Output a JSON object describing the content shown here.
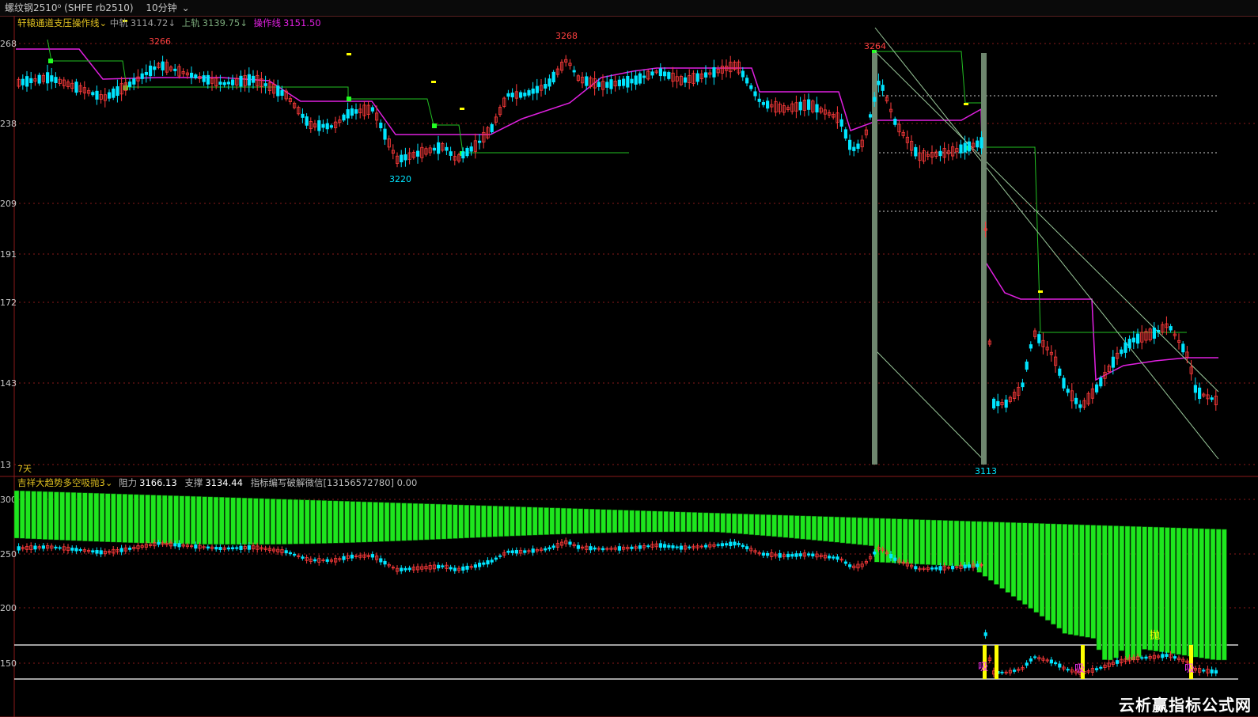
{
  "header": {
    "instrument": "螺纹钢2510⁰ (SHFE rb2510)",
    "period": "10分钟"
  },
  "indicators": {
    "main_name": "轩辕通道支压操作线",
    "main_mid_label": "中轨",
    "main_mid_value": "3114.72↓",
    "main_up_label": "上轨",
    "main_up_value": "3139.75↓",
    "main_op_label": "操作线",
    "main_op_value": "3151.50",
    "sub_name": "吉祥大趋势多空吸抛3",
    "sub_res_label": "阻力",
    "sub_res_value": "3166.13",
    "sub_sup_label": "支撑",
    "sub_sup_value": "3134.44",
    "sub_note": "指标编写破解微信[13156572780] 0.00",
    "days_label": "7天"
  },
  "watermark": "云析赢指标公式网",
  "colors": {
    "up": "#ff3b3b",
    "down": "#00e5ff",
    "op_line": "#e020e0",
    "step_line": "#22c022",
    "channel": "#9ac89a",
    "bars": "#1ee61e",
    "grid": "#8a1a1a",
    "yellow": "#ffff00"
  },
  "chart_data": [
    {
      "type": "candlestick",
      "ylim": [
        3113,
        3271
      ],
      "yticks": [
        "268",
        "238",
        "209",
        "191",
        "172",
        "143",
        "13"
      ],
      "annotations": [
        "3266",
        "3268",
        "3264",
        "3220",
        "3113"
      ],
      "series": [
        {
          "name": "中轨",
          "value": 3114.72
        },
        {
          "name": "上轨",
          "value": 3139.75
        },
        {
          "name": "操作线",
          "value": 3151.5
        }
      ]
    },
    {
      "type": "bar",
      "yticks": [
        "300",
        "250",
        "200",
        "150"
      ],
      "labels": [
        "吸",
        "吸",
        "吸",
        "抛"
      ],
      "series": [
        {
          "name": "阻力",
          "value": 3166.13
        },
        {
          "name": "支撑",
          "value": 3134.44
        }
      ]
    }
  ]
}
